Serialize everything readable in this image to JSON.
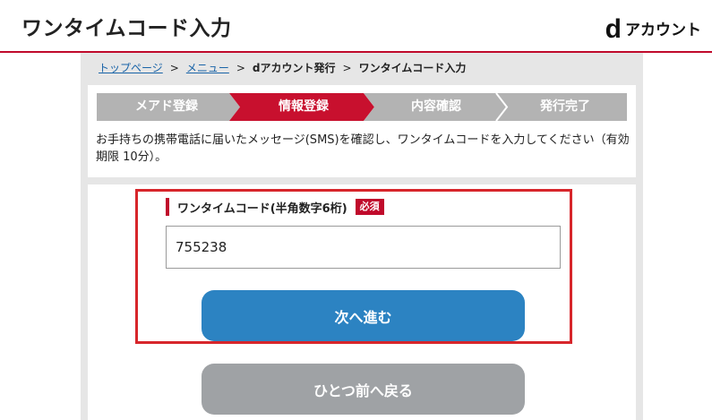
{
  "header": {
    "title": "ワンタイムコード入力",
    "logo_mark": "d",
    "logo_text": "アカウント"
  },
  "breadcrumb": [
    {
      "label": "トップページ",
      "link": true
    },
    {
      "label": "メニュー",
      "link": true
    },
    {
      "label": "dアカウント発行",
      "link": false
    },
    {
      "label": "ワンタイムコード入力",
      "link": false
    }
  ],
  "breadcrumb_separator": ">",
  "steps": [
    {
      "label": "メアド登録",
      "active": false
    },
    {
      "label": "情報登録",
      "active": true
    },
    {
      "label": "内容確認",
      "active": false
    },
    {
      "label": "発行完了",
      "active": false
    }
  ],
  "notice": "お手持ちの携帯電話に届いたメッセージ(SMS)を確認し、ワンタイムコードを入力してください（有効期限 10分）。",
  "form": {
    "field_label": "ワンタイムコード(半角数字6桁)",
    "required_badge": "必須",
    "code_value": "755238"
  },
  "buttons": {
    "next": "次へ進む",
    "back": "ひとつ前へ戻る"
  },
  "colors": {
    "brand_red": "#c00a2b",
    "step_active": "#c8102e",
    "step_inactive": "#b3b3b3",
    "primary_button": "#2c83c2",
    "secondary_button": "#9fa2a5",
    "highlight_frame": "#d7262b",
    "link": "#1a64a8"
  }
}
